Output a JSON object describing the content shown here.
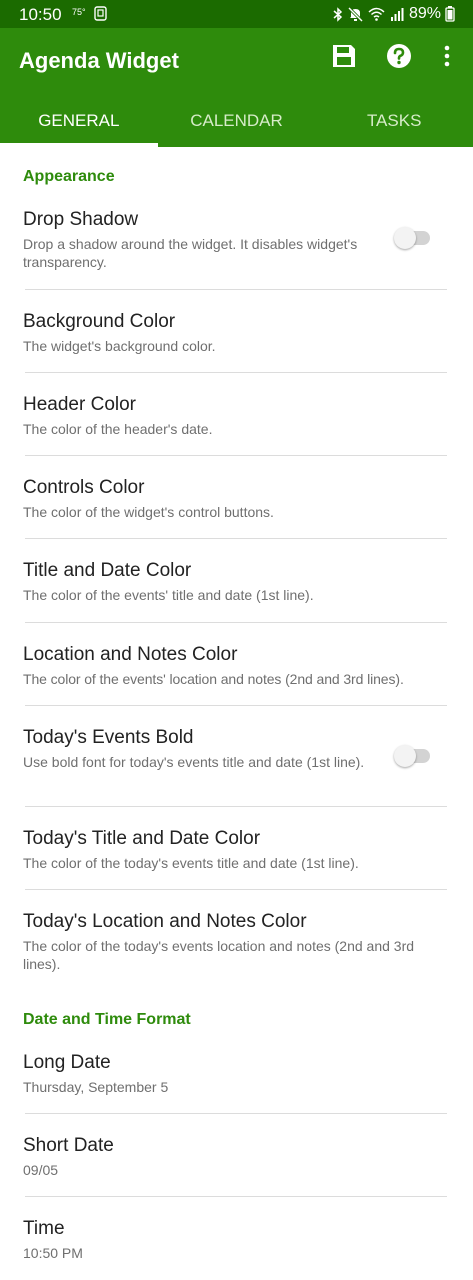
{
  "status_bar": {
    "time": "10:50",
    "temperature": "75°",
    "battery": "89%",
    "icons": [
      "bluetooth-icon",
      "mute-icon",
      "wifi-icon",
      "signal-icon",
      "battery-icon"
    ]
  },
  "app_bar": {
    "title": "Agenda Widget",
    "actions": [
      "save-icon",
      "help-icon",
      "more-vert-icon"
    ]
  },
  "tabs": [
    {
      "label": "GENERAL",
      "selected": true
    },
    {
      "label": "CALENDAR",
      "selected": false
    },
    {
      "label": "TASKS",
      "selected": false
    }
  ],
  "sections": [
    {
      "header": "Appearance",
      "prefs": [
        {
          "title": "Drop Shadow",
          "summary": "Drop a shadow around the widget. It disables widget's transparency.",
          "toggle": false
        },
        {
          "title": "Background Color",
          "summary": "The widget's background color."
        },
        {
          "title": "Header Color",
          "summary": "The color of the header's date."
        },
        {
          "title": "Controls Color",
          "summary": "The color of the widget's control buttons."
        },
        {
          "title": "Title and Date Color",
          "summary": "The color of the events' title and date (1st line)."
        },
        {
          "title": "Location and Notes Color",
          "summary": "The color of the events' location and notes (2nd and 3rd lines)."
        },
        {
          "title": "Today's Events Bold",
          "summary": "Use bold font for today's events title and date (1st line).",
          "toggle": false
        },
        {
          "title": "Today's Title and Date Color",
          "summary": "The color of the today's events title and date (1st line)."
        },
        {
          "title": "Today's Location and Notes Color",
          "summary": "The color of the today's events location and notes (2nd and 3rd lines)."
        }
      ]
    },
    {
      "header": "Date and Time Format",
      "prefs": [
        {
          "title": "Long Date",
          "summary": "Thursday, September 5"
        },
        {
          "title": "Short Date",
          "summary": "09/05"
        },
        {
          "title": "Time",
          "summary": "10:50 PM"
        }
      ]
    }
  ],
  "colors": {
    "status_bar": "#1b6b00",
    "primary": "#2e8b0c",
    "accent_text": "#2e8b0c"
  }
}
